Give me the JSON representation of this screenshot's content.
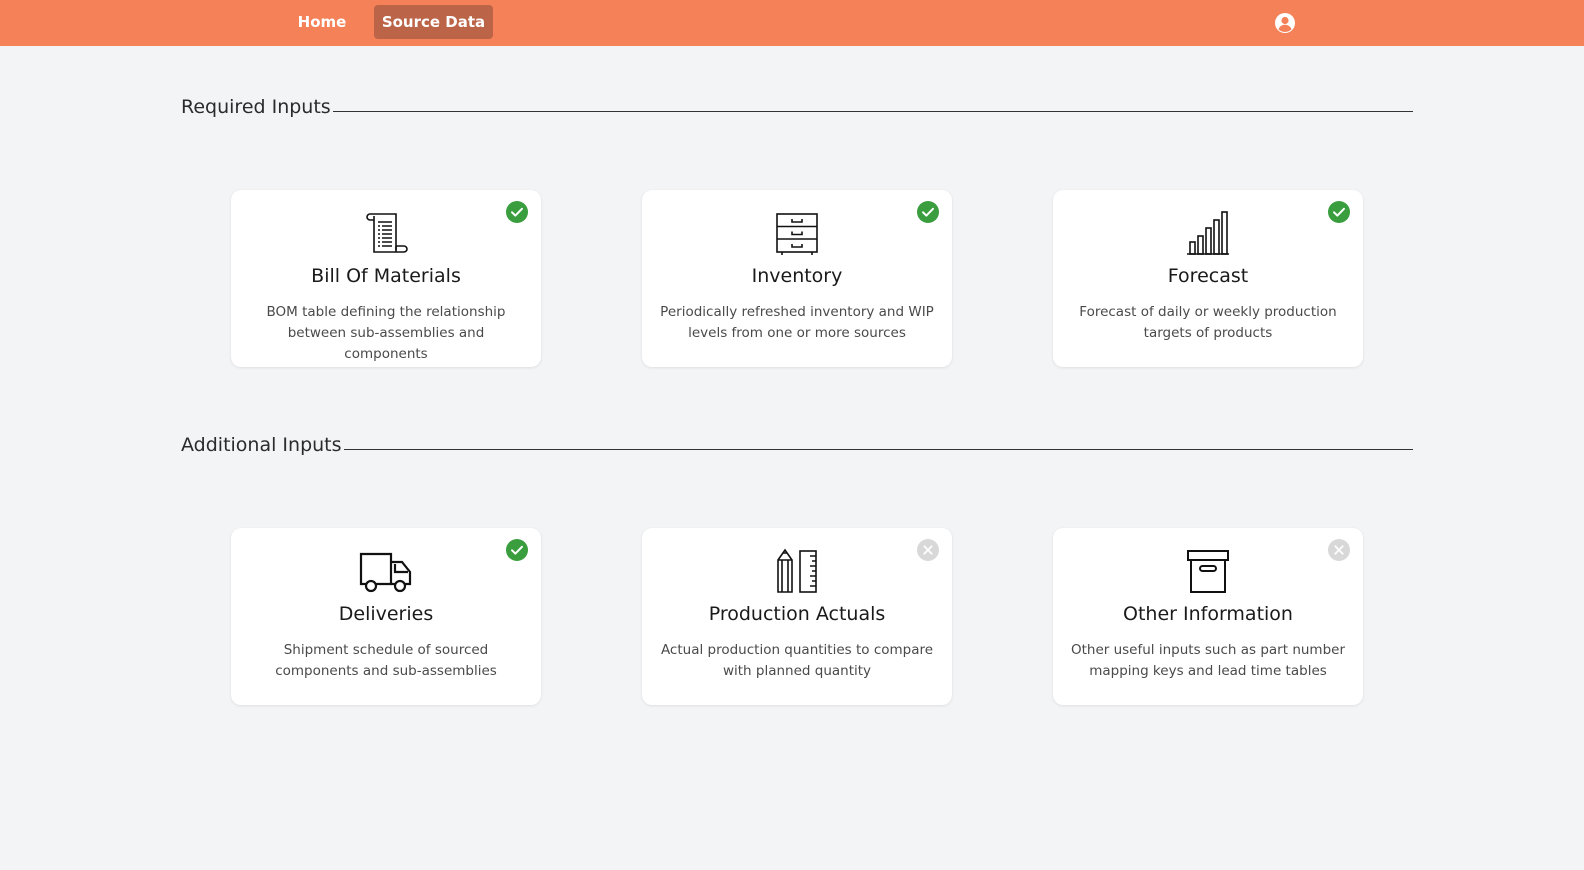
{
  "nav": {
    "home_label": "Home",
    "source_data_label": "Source Data",
    "active": "Source Data"
  },
  "colors": {
    "header_bg": "#f48158",
    "active_tab_bg": "#bc6448",
    "status_complete": "#3a9e3f",
    "status_missing": "#d8d8d8"
  },
  "sections": {
    "required": {
      "title": "Required Inputs",
      "cards": [
        {
          "title": "Bill Of Materials",
          "description": "BOM table defining the relationship between sub-assemblies and components",
          "icon": "scroll-document-icon",
          "status": "complete"
        },
        {
          "title": "Inventory",
          "description": "Periodically refreshed inventory and WIP levels from one or more sources",
          "icon": "cabinet-drawers-icon",
          "status": "complete"
        },
        {
          "title": "Forecast",
          "description": "Forecast of daily or weekly production targets of products",
          "icon": "bar-chart-icon",
          "status": "complete"
        }
      ]
    },
    "additional": {
      "title": "Additional Inputs",
      "cards": [
        {
          "title": "Deliveries",
          "description": "Shipment schedule of sourced components and sub-assemblies",
          "icon": "truck-icon",
          "status": "complete"
        },
        {
          "title": "Production Actuals",
          "description": "Actual production quantities to compare with planned quantity",
          "icon": "pencil-ruler-icon",
          "status": "missing"
        },
        {
          "title": "Other Information",
          "description": "Other useful inputs such as part number mapping keys and lead time tables",
          "icon": "archive-box-icon",
          "status": "missing"
        }
      ]
    }
  }
}
